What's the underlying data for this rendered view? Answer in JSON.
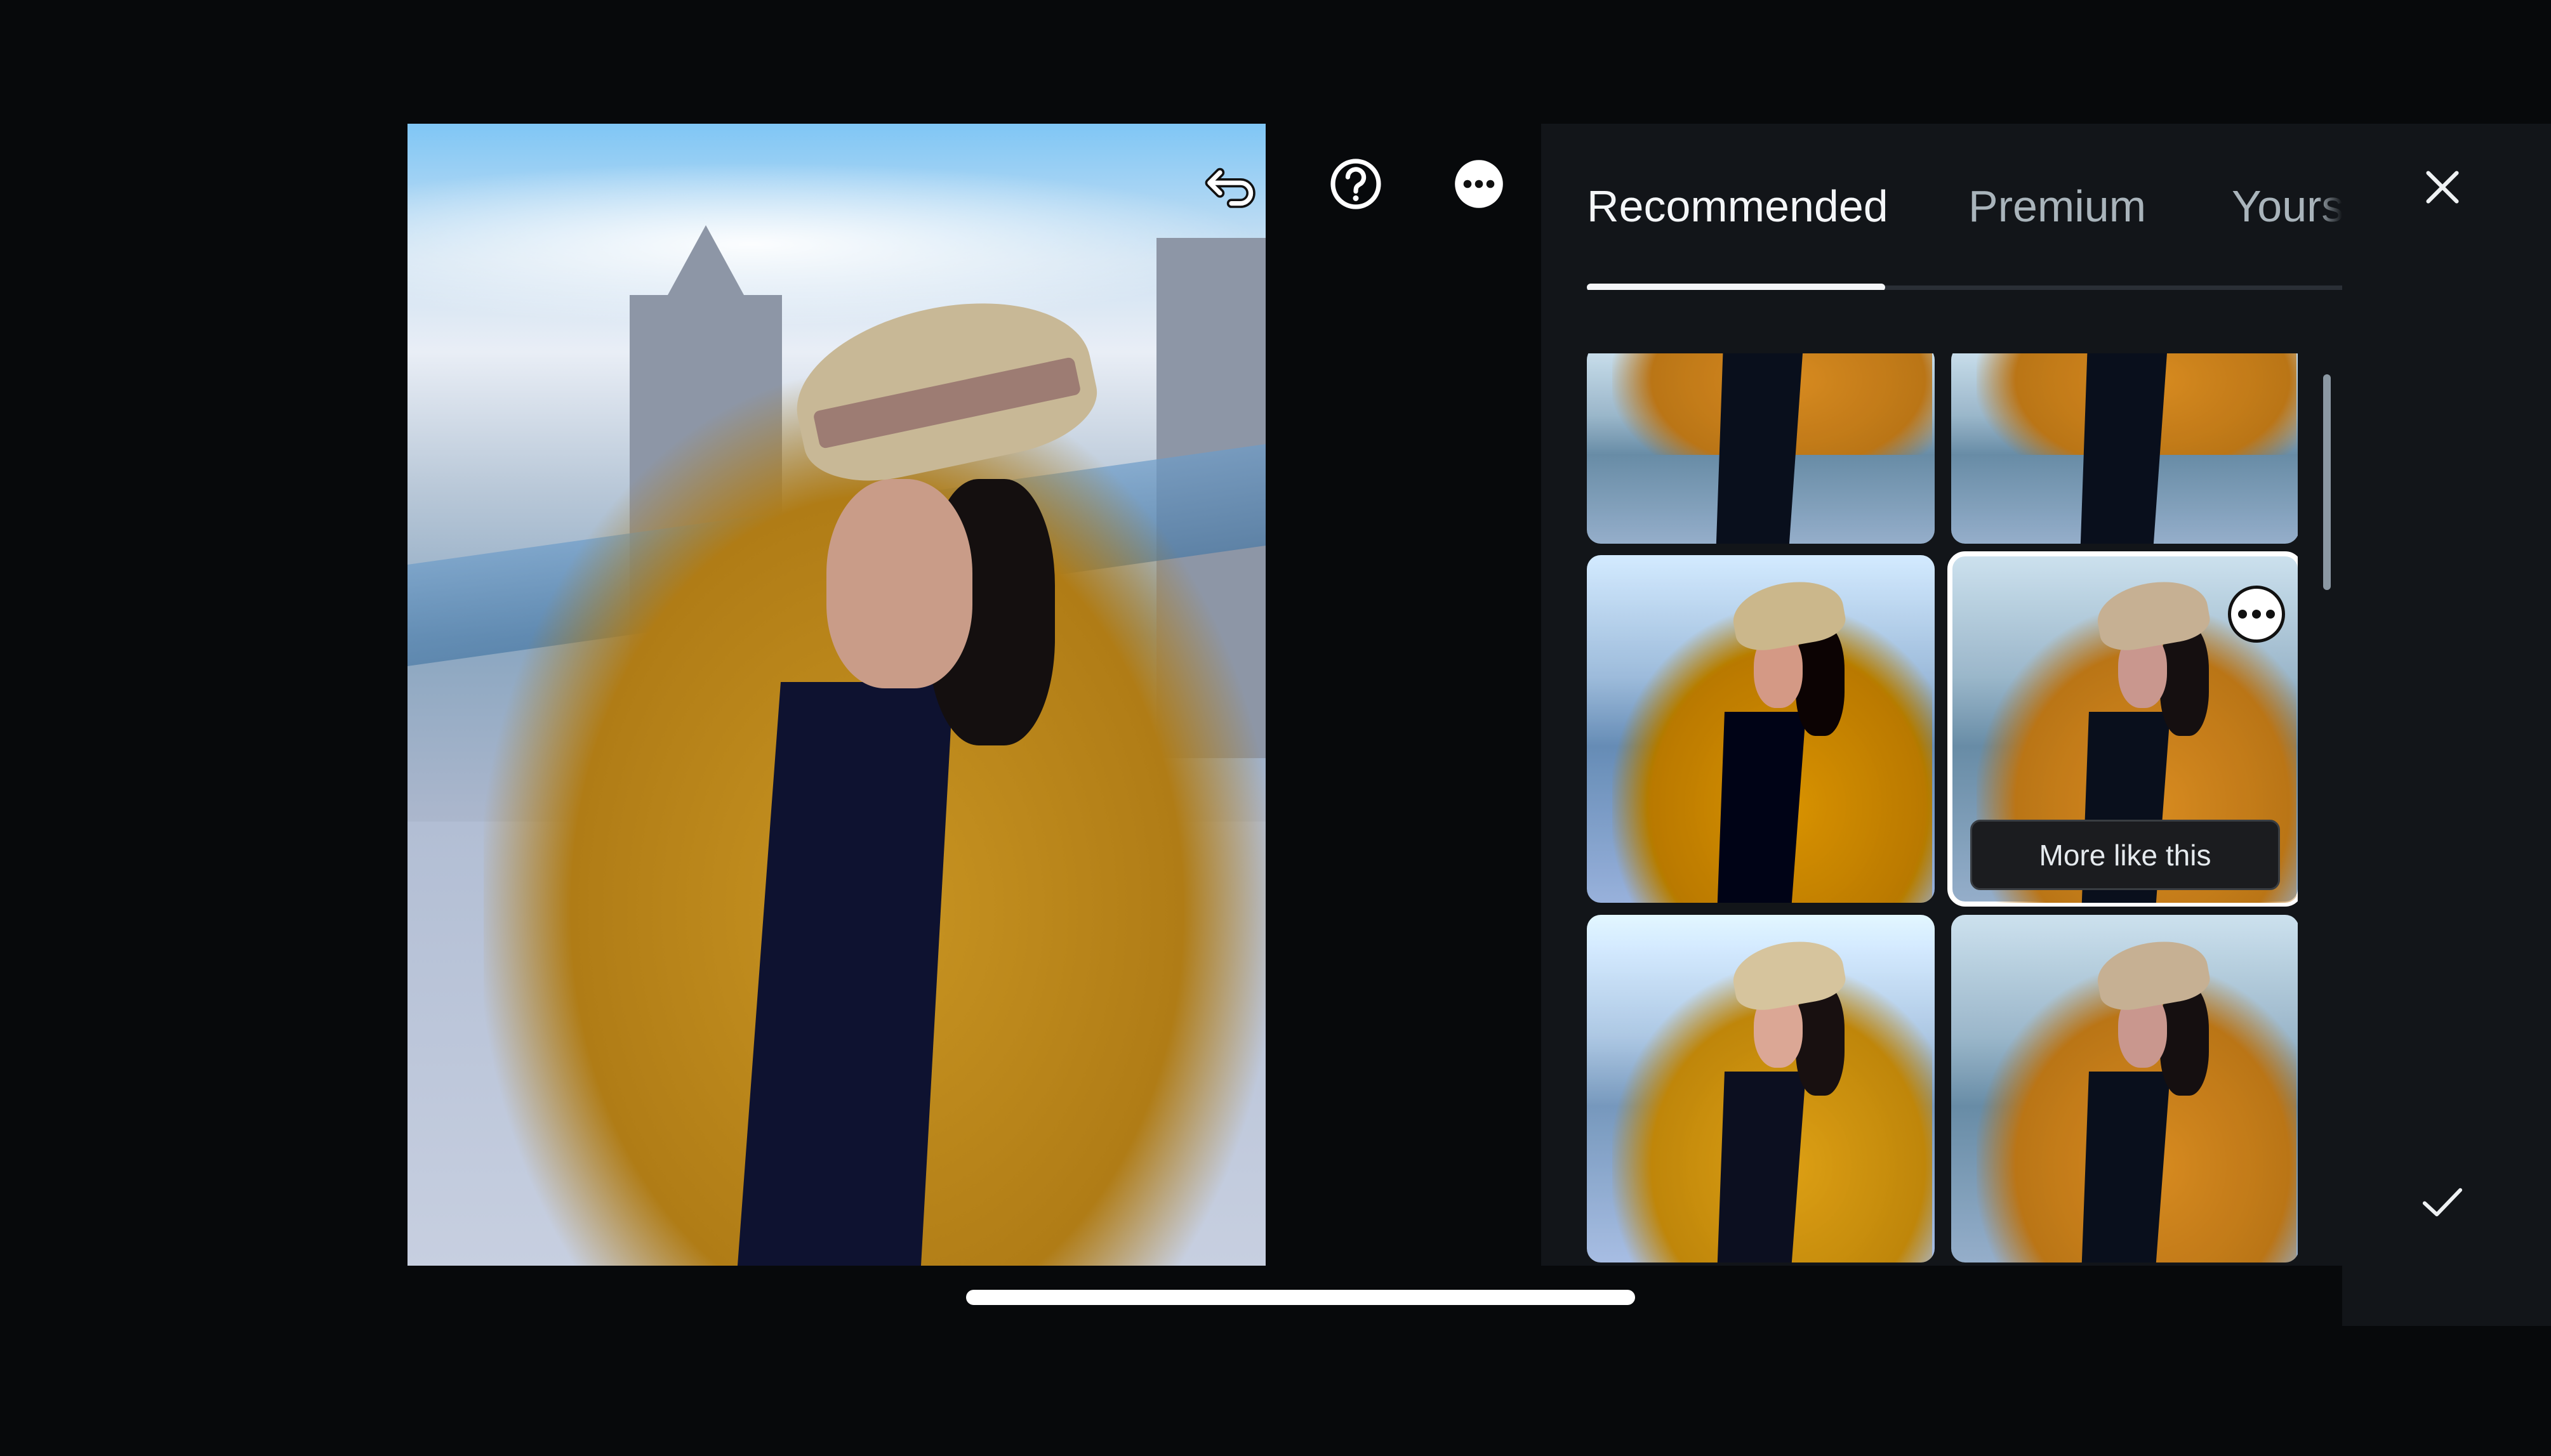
{
  "toolbar": {
    "undo_icon": "undo-arrow-icon",
    "help_icon": "help-circle-icon",
    "more_icon": "more-options-icon"
  },
  "photo": {
    "subject": "Woman in straw hat and mustard cardigan in front of Tower Bridge"
  },
  "tabs": [
    {
      "label": "Recommended",
      "active": true
    },
    {
      "label": "Premium",
      "active": false
    },
    {
      "label": "Yours",
      "active": false
    }
  ],
  "presets": {
    "thumbnails": [
      {
        "style": "cool",
        "cropped": true,
        "selected": false
      },
      {
        "style": "cool",
        "cropped": true,
        "selected": false
      },
      {
        "style": "warm",
        "cropped": false,
        "selected": false
      },
      {
        "style": "cool",
        "cropped": false,
        "selected": true,
        "action_label": "More like this",
        "more_icon": "more-options-icon"
      },
      {
        "style": "light",
        "cropped": false,
        "selected": false
      },
      {
        "style": "cool",
        "cropped": false,
        "selected": false
      }
    ]
  },
  "rail": {
    "close_icon": "close-icon",
    "confirm_icon": "checkmark-icon"
  },
  "colors": {
    "background": "#07090b",
    "panel": "#121519",
    "active_tab": "#f4f6f8",
    "inactive_tab": "#a9b4bb",
    "tooltip_bg": "#1b1c1f"
  }
}
